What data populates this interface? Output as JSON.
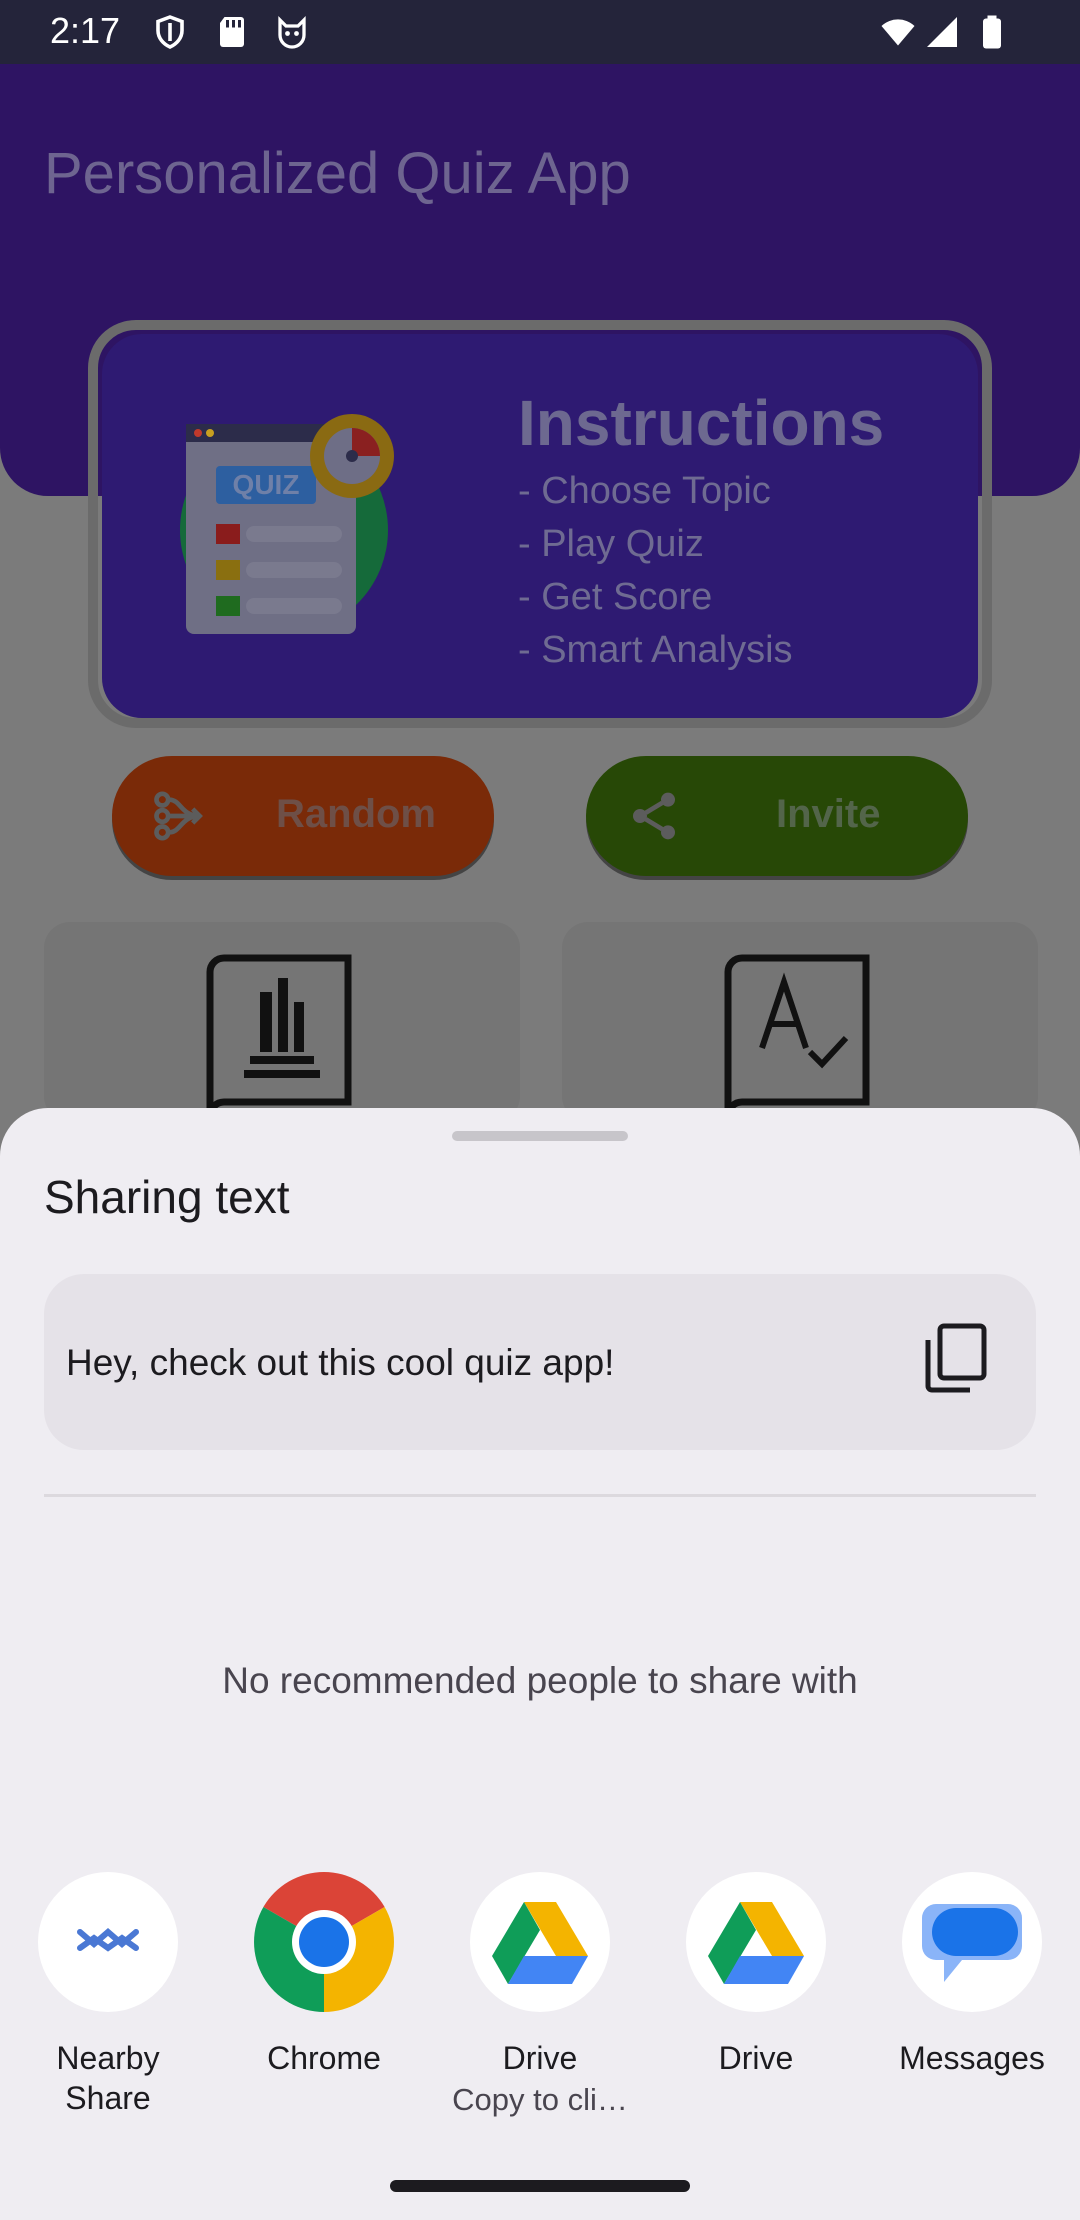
{
  "status": {
    "time": "2:17"
  },
  "app": {
    "title": "Personalized Quiz App",
    "illustration_text": "QUIZ",
    "instructions": {
      "title": "Instructions",
      "lines": [
        "- Choose Topic",
        "- Play Quiz",
        "- Get Score",
        "- Smart Analysis"
      ]
    },
    "buttons": {
      "random": "Random",
      "invite": "Invite"
    }
  },
  "share_sheet": {
    "title": "Sharing text",
    "text": "Hey, check out this cool quiz app!",
    "no_recommendations": "No recommended people to share with",
    "targets": [
      {
        "label": "Nearby\nShare",
        "sublabel": "",
        "icon": "nearby-share-icon"
      },
      {
        "label": "Chrome",
        "sublabel": "",
        "icon": "chrome-icon"
      },
      {
        "label": "Drive",
        "sublabel": "Copy to cli…",
        "icon": "drive-icon"
      },
      {
        "label": "Drive",
        "sublabel": "",
        "icon": "drive-icon"
      },
      {
        "label": "Messages",
        "sublabel": "",
        "icon": "messages-icon"
      }
    ]
  }
}
